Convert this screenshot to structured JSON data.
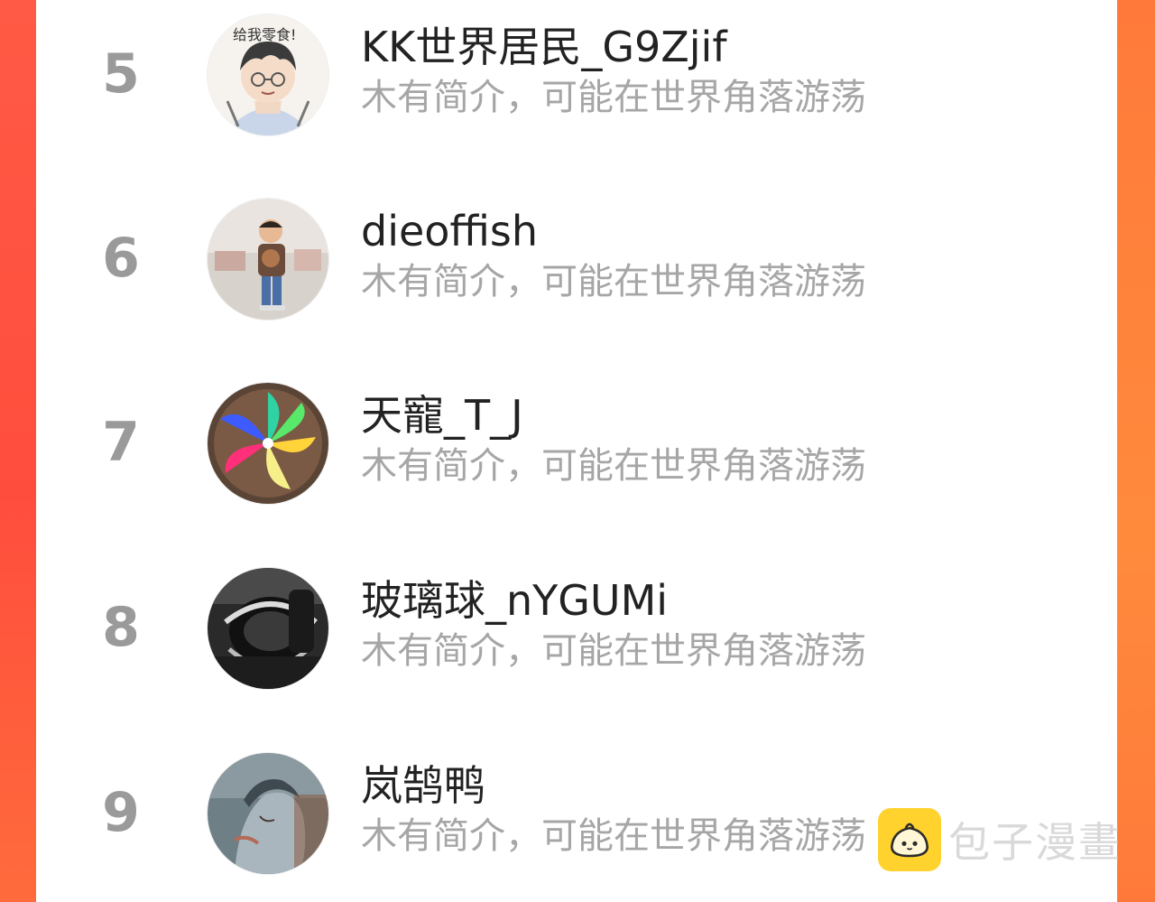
{
  "ranking": {
    "items": [
      {
        "rank": "5",
        "name": "KK世界居民_G9Zjif",
        "bio": "木有简介，可能在世界角落游荡",
        "avatar_icon": "cartoon-boy-avatar"
      },
      {
        "rank": "6",
        "name": "dieoffish",
        "bio": "木有简介，可能在世界角落游荡",
        "avatar_icon": "child-photo-avatar"
      },
      {
        "rank": "7",
        "name": "天寵_T_J",
        "bio": "木有简介，可能在世界角落游荡",
        "avatar_icon": "pinwheel-avatar"
      },
      {
        "rank": "8",
        "name": "玻璃球_nYGUMi",
        "bio": "木有简介，可能在世界角落游荡",
        "avatar_icon": "black-white-object-avatar"
      },
      {
        "rank": "9",
        "name": "岚鹄鸭",
        "bio": "木有简介，可能在世界角落游荡",
        "avatar_icon": "anime-illustration-avatar"
      }
    ]
  },
  "watermark": {
    "text": "包子漫畫",
    "logo_icon": "baozi-logo-icon"
  },
  "colors": {
    "background_red": "#ff4d3d",
    "edge_orange": "#ff7a3a",
    "rank_gray": "#9a9a9a",
    "name_dark": "#222222",
    "bio_gray": "#a6a6a6",
    "logo_yellow": "#ffd22e"
  }
}
